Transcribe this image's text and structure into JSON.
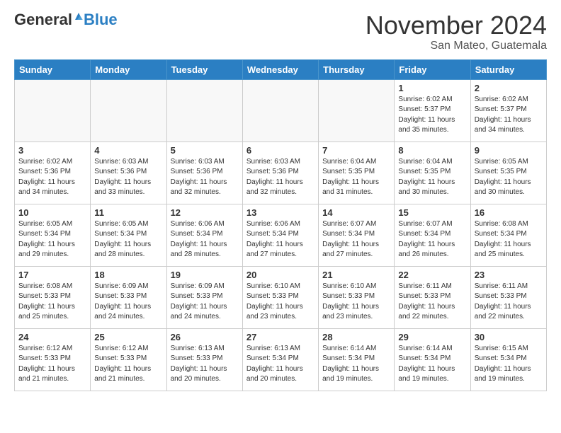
{
  "header": {
    "logo_general": "General",
    "logo_blue": "Blue",
    "month_title": "November 2024",
    "subtitle": "San Mateo, Guatemala"
  },
  "days_of_week": [
    "Sunday",
    "Monday",
    "Tuesday",
    "Wednesday",
    "Thursday",
    "Friday",
    "Saturday"
  ],
  "weeks": [
    [
      {
        "day": "",
        "info": ""
      },
      {
        "day": "",
        "info": ""
      },
      {
        "day": "",
        "info": ""
      },
      {
        "day": "",
        "info": ""
      },
      {
        "day": "",
        "info": ""
      },
      {
        "day": "1",
        "info": "Sunrise: 6:02 AM\nSunset: 5:37 PM\nDaylight: 11 hours\nand 35 minutes."
      },
      {
        "day": "2",
        "info": "Sunrise: 6:02 AM\nSunset: 5:37 PM\nDaylight: 11 hours\nand 34 minutes."
      }
    ],
    [
      {
        "day": "3",
        "info": "Sunrise: 6:02 AM\nSunset: 5:36 PM\nDaylight: 11 hours\nand 34 minutes."
      },
      {
        "day": "4",
        "info": "Sunrise: 6:03 AM\nSunset: 5:36 PM\nDaylight: 11 hours\nand 33 minutes."
      },
      {
        "day": "5",
        "info": "Sunrise: 6:03 AM\nSunset: 5:36 PM\nDaylight: 11 hours\nand 32 minutes."
      },
      {
        "day": "6",
        "info": "Sunrise: 6:03 AM\nSunset: 5:36 PM\nDaylight: 11 hours\nand 32 minutes."
      },
      {
        "day": "7",
        "info": "Sunrise: 6:04 AM\nSunset: 5:35 PM\nDaylight: 11 hours\nand 31 minutes."
      },
      {
        "day": "8",
        "info": "Sunrise: 6:04 AM\nSunset: 5:35 PM\nDaylight: 11 hours\nand 30 minutes."
      },
      {
        "day": "9",
        "info": "Sunrise: 6:05 AM\nSunset: 5:35 PM\nDaylight: 11 hours\nand 30 minutes."
      }
    ],
    [
      {
        "day": "10",
        "info": "Sunrise: 6:05 AM\nSunset: 5:34 PM\nDaylight: 11 hours\nand 29 minutes."
      },
      {
        "day": "11",
        "info": "Sunrise: 6:05 AM\nSunset: 5:34 PM\nDaylight: 11 hours\nand 28 minutes."
      },
      {
        "day": "12",
        "info": "Sunrise: 6:06 AM\nSunset: 5:34 PM\nDaylight: 11 hours\nand 28 minutes."
      },
      {
        "day": "13",
        "info": "Sunrise: 6:06 AM\nSunset: 5:34 PM\nDaylight: 11 hours\nand 27 minutes."
      },
      {
        "day": "14",
        "info": "Sunrise: 6:07 AM\nSunset: 5:34 PM\nDaylight: 11 hours\nand 27 minutes."
      },
      {
        "day": "15",
        "info": "Sunrise: 6:07 AM\nSunset: 5:34 PM\nDaylight: 11 hours\nand 26 minutes."
      },
      {
        "day": "16",
        "info": "Sunrise: 6:08 AM\nSunset: 5:34 PM\nDaylight: 11 hours\nand 25 minutes."
      }
    ],
    [
      {
        "day": "17",
        "info": "Sunrise: 6:08 AM\nSunset: 5:33 PM\nDaylight: 11 hours\nand 25 minutes."
      },
      {
        "day": "18",
        "info": "Sunrise: 6:09 AM\nSunset: 5:33 PM\nDaylight: 11 hours\nand 24 minutes."
      },
      {
        "day": "19",
        "info": "Sunrise: 6:09 AM\nSunset: 5:33 PM\nDaylight: 11 hours\nand 24 minutes."
      },
      {
        "day": "20",
        "info": "Sunrise: 6:10 AM\nSunset: 5:33 PM\nDaylight: 11 hours\nand 23 minutes."
      },
      {
        "day": "21",
        "info": "Sunrise: 6:10 AM\nSunset: 5:33 PM\nDaylight: 11 hours\nand 23 minutes."
      },
      {
        "day": "22",
        "info": "Sunrise: 6:11 AM\nSunset: 5:33 PM\nDaylight: 11 hours\nand 22 minutes."
      },
      {
        "day": "23",
        "info": "Sunrise: 6:11 AM\nSunset: 5:33 PM\nDaylight: 11 hours\nand 22 minutes."
      }
    ],
    [
      {
        "day": "24",
        "info": "Sunrise: 6:12 AM\nSunset: 5:33 PM\nDaylight: 11 hours\nand 21 minutes."
      },
      {
        "day": "25",
        "info": "Sunrise: 6:12 AM\nSunset: 5:33 PM\nDaylight: 11 hours\nand 21 minutes."
      },
      {
        "day": "26",
        "info": "Sunrise: 6:13 AM\nSunset: 5:33 PM\nDaylight: 11 hours\nand 20 minutes."
      },
      {
        "day": "27",
        "info": "Sunrise: 6:13 AM\nSunset: 5:34 PM\nDaylight: 11 hours\nand 20 minutes."
      },
      {
        "day": "28",
        "info": "Sunrise: 6:14 AM\nSunset: 5:34 PM\nDaylight: 11 hours\nand 19 minutes."
      },
      {
        "day": "29",
        "info": "Sunrise: 6:14 AM\nSunset: 5:34 PM\nDaylight: 11 hours\nand 19 minutes."
      },
      {
        "day": "30",
        "info": "Sunrise: 6:15 AM\nSunset: 5:34 PM\nDaylight: 11 hours\nand 19 minutes."
      }
    ]
  ]
}
